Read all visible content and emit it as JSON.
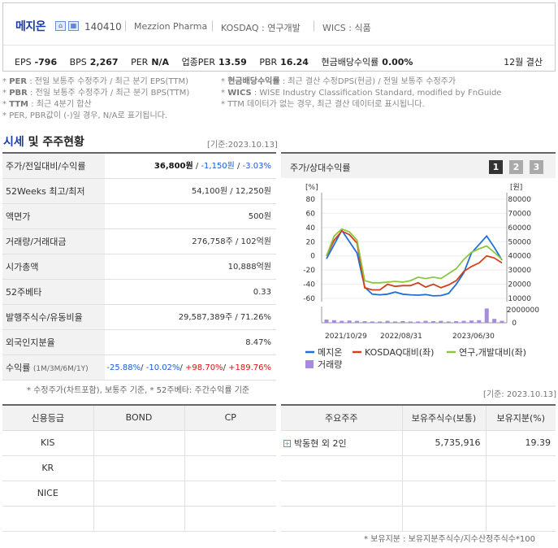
{
  "company": {
    "name": "메지온",
    "code": "140410",
    "english_name": "Mezzion Pharma",
    "market": "KOSDAQ : 연구개발",
    "wics": "WICS : 식품"
  },
  "indicators": {
    "eps_label": "EPS",
    "eps": "-796",
    "bps_label": "BPS",
    "bps": "2,267",
    "per_label": "PER",
    "per": "N/A",
    "industry_per_label": "업종PER",
    "industry_per": "13.59",
    "pbr_label": "PBR",
    "pbr": "16.24",
    "dividend_label": "현금배당수익률",
    "dividend": "0.00%",
    "settlement": "12월 결산"
  },
  "notes": {
    "left": [
      {
        "key": "PER",
        "text": ": 전일 보통주 수정주가 / 최근 분기 EPS(TTM)"
      },
      {
        "key": "PBR",
        "text": ": 전일 보통주 수정주가 / 최근 분기 BPS(TTM)"
      },
      {
        "key": "TTM",
        "text": ": 최근 4분기 합산"
      },
      {
        "key": "",
        "text": "PER, PBR값이 (-)일 경우, N/A로 표기됩니다."
      }
    ],
    "right": [
      {
        "key": "현금배당수익률",
        "text": ": 최근 결산 수정DPS(현금) / 전일 보통주 수정주가"
      },
      {
        "key": "WICS",
        "text": ": WISE Industry Classification Standard, modified by FnGuide"
      },
      {
        "key": "",
        "text": "TTM 데이터가 없는 경우, 최근 결산 데이터로 표시됩니다."
      }
    ]
  },
  "section": {
    "title_blue": "시세",
    "title_rest": " 및 주주현황",
    "base_date": "[기준:2023.10.13]"
  },
  "market_table": [
    {
      "label": "주가/전일대비/수익률",
      "price": "36,800원",
      "change": "-1,150원",
      "rate": "-3.03%"
    },
    {
      "label": "52Weeks 최고/최저",
      "value": "54,100원 / 12,250원"
    },
    {
      "label": "액면가",
      "value": "500원"
    },
    {
      "label": "거래량/거래대금",
      "value": "276,758주 / 102억원"
    },
    {
      "label": "시가총액",
      "value": "10,888억원"
    },
    {
      "label": "52주베타",
      "value": "0.33"
    },
    {
      "label": "발행주식수/유동비율",
      "value": "29,587,389주 / 71.26%"
    },
    {
      "label": "외국인지분율",
      "value": "8.47%"
    },
    {
      "label": "수익률",
      "sublabel": "(1M/3M/6M/1Y)",
      "r1": "-25.88%",
      "r2": "-10.02%",
      "r3": "+98.70%",
      "r4": "+189.76%"
    }
  ],
  "market_footnote": "* 수정주가(차트포함), 보통주 기준, * 52주베타: 주간수익률 기준",
  "chart_panel": {
    "title": "주가/상대수익률",
    "buttons": [
      "1",
      "2",
      "3"
    ]
  },
  "chart_data": {
    "type": "line",
    "left_axis_unit": "[%]",
    "right_axis_unit": "[원]",
    "left_ticks": [
      "80",
      "60",
      "40",
      "20",
      "0",
      "-20",
      "-40",
      "-60"
    ],
    "right_ticks": [
      "80000",
      "70000",
      "60000",
      "50000",
      "40000",
      "30000",
      "20000",
      "10000"
    ],
    "volume_ticks": [
      "2000000",
      "0"
    ],
    "x_ticks": [
      "2021/10/29",
      "2022/08/31",
      "2023/06/30"
    ],
    "ylim_left": [
      -60,
      80
    ],
    "ylim_right": [
      10000,
      80000
    ],
    "series": [
      {
        "name": "메지온",
        "color": "#1f6fd6",
        "axis": "right",
        "values": [
          38000,
          48000,
          58000,
          50000,
          42000,
          18000,
          13000,
          12500,
          13000,
          14500,
          13000,
          12500,
          12300,
          12700,
          11800,
          12000,
          13500,
          20000,
          28000,
          42000,
          48000,
          54000,
          46000,
          37000
        ]
      },
      {
        "name": "KOSDAQ대비(좌)",
        "color": "#d2401c",
        "axis": "left",
        "values": [
          0,
          22,
          35,
          30,
          18,
          -45,
          -48,
          -48,
          -40,
          -43,
          -42,
          -42,
          -38,
          -44,
          -40,
          -45,
          -41,
          -35,
          -22,
          -15,
          -10,
          0,
          -3,
          -10
        ]
      },
      {
        "name": "연구,개발대비(좌)",
        "color": "#8cc63f",
        "axis": "left",
        "values": [
          0,
          28,
          38,
          34,
          22,
          -35,
          -38,
          -38,
          -37,
          -36,
          -37,
          -35,
          -30,
          -32,
          -30,
          -32,
          -25,
          -18,
          -5,
          5,
          10,
          14,
          5,
          -5
        ]
      }
    ],
    "volume": {
      "name": "거래량",
      "color": "#a78bdc",
      "values": [
        500000,
        400000,
        300000,
        350000,
        300000,
        250000,
        200000,
        200000,
        300000,
        200000,
        250000,
        200000,
        200000,
        300000,
        250000,
        300000,
        200000,
        250000,
        300000,
        350000,
        400000,
        2200000,
        600000,
        300000
      ]
    },
    "legend": [
      {
        "name": "메지온",
        "color": "#1f6fd6",
        "kind": "line"
      },
      {
        "name": "KOSDAQ대비(좌)",
        "color": "#d2401c",
        "kind": "line"
      },
      {
        "name": "연구,개발대비(좌)",
        "color": "#8cc63f",
        "kind": "line"
      },
      {
        "name": "거래량",
        "color": "#a78bdc",
        "kind": "box"
      }
    ]
  },
  "credit_table": {
    "headers": [
      "신용등급",
      "BOND",
      "CP"
    ],
    "rows": [
      "KIS",
      "KR",
      "NICE",
      ""
    ]
  },
  "holders": {
    "base_date": "[기준: 2023.10.13]",
    "headers": [
      "주요주주",
      "보유주식수(보통)",
      "보유지분(%)"
    ],
    "rows": [
      {
        "name": "박동현 외 2인",
        "shares": "5,735,916",
        "pct": "19.39"
      }
    ],
    "footnote": "* 보유지분 : 보유지분주식수/지수산정주식수*100"
  }
}
